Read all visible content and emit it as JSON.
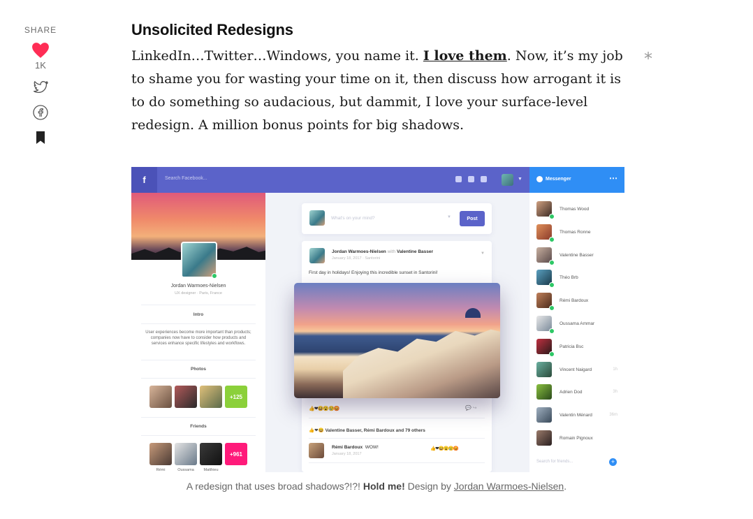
{
  "share": {
    "label": "SHARE",
    "like_count": "1K",
    "icons": [
      "heart-icon",
      "twitter-icon",
      "facebook-icon",
      "bookmark-icon"
    ],
    "heart_color": "#ff2d55"
  },
  "article": {
    "headline": "Unsolicited Redesigns",
    "paragraph_before_link": "LinkedIn…Twitter…Windows, you name it. ",
    "link_text": "I love them",
    "paragraph_after_link": ". Now, it’s my job to shame you for wasting your time on it, then discuss how arrogant it is to do something so audacious, but dammit, I love your surface-level redesign. A million bonus points for big shadows.",
    "marker": "*"
  },
  "figure": {
    "topbar": {
      "logo": "f",
      "search_placeholder": "Search Facebook...",
      "accent": "#5b63c9"
    },
    "profile": {
      "name": "Jordan Warmoes-Nielsen",
      "subtitle": "UX designer  ·  Paris, France",
      "intro_title": "Intro",
      "intro_text": "User experiences become more important than products; companies now have to consider how products and services enhance specific lifestyles and workflows.",
      "photos_title": "Photos",
      "photos_more": "+125",
      "friends_title": "Friends",
      "friends_more": "+961",
      "friend_names": [
        "Rémi",
        "Oussama",
        "Matthieu"
      ]
    },
    "composer": {
      "placeholder": "What's on your mind?",
      "post_label": "Post"
    },
    "post": {
      "author": "Jordan Warmoes-Nielsen",
      "with_word": "with",
      "tagged": "Valentine Basser",
      "date": "January 18, 2017  ·  Santorini",
      "text": "First day in holidays! Enjoying this incredible sunset in Santorini!",
      "reactions": "👍❤😆😮😢😡",
      "reacted_by": "Valentine Basser, Rémi Bardoux and 79 others",
      "comment_author": "Rémi Bardoux",
      "comment_text": "WOW!",
      "comment_date": "January 18, 2017",
      "comment_reactions": "👍❤😆😮😢😡"
    },
    "messenger": {
      "title": "Messenger",
      "accent": "#2f8ef5",
      "contacts": [
        {
          "name": "Thomas Wood",
          "time": ""
        },
        {
          "name": "Thomas Ronne",
          "time": ""
        },
        {
          "name": "Valentine Basser",
          "time": ""
        },
        {
          "name": "Théo Brb",
          "time": ""
        },
        {
          "name": "Rémi Bardoux",
          "time": ""
        },
        {
          "name": "Oussama Ammar",
          "time": ""
        },
        {
          "name": "Patricia Bsc",
          "time": ""
        },
        {
          "name": "Vincent Naigard",
          "time": "1h"
        },
        {
          "name": "Adrien Dod",
          "time": "3h"
        },
        {
          "name": "Valentin Ménard",
          "time": "36m"
        },
        {
          "name": "Romain Pignoux",
          "time": ""
        }
      ],
      "search_placeholder": "Search for friends..."
    }
  },
  "caption": {
    "before": "A redesign that uses broad shadows?!?! ",
    "bold": "Hold me!",
    "middle": " Design by ",
    "link": "Jordan Warmoes-Nielsen",
    "after": "."
  }
}
